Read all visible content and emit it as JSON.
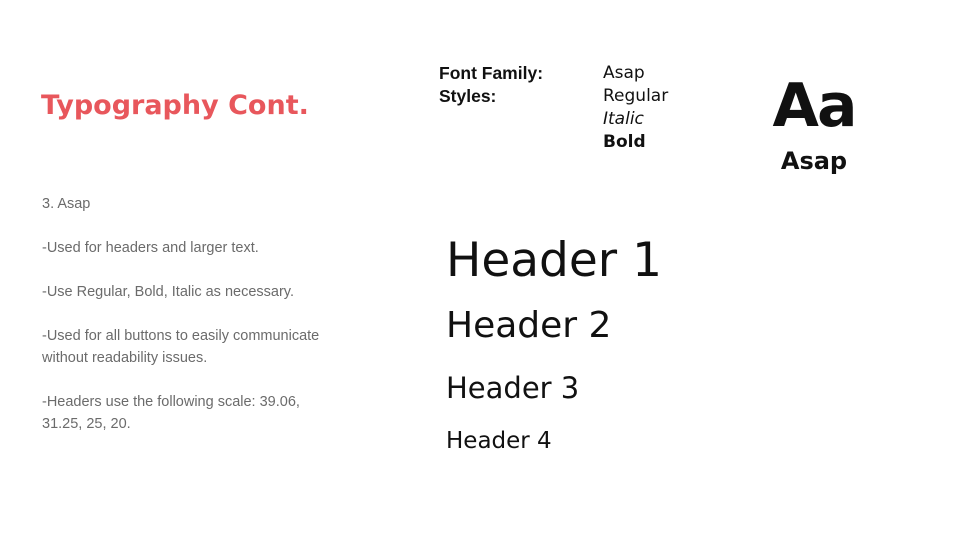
{
  "title": "Typography Cont.",
  "notes": [
    "3. Asap",
    "-Used for headers and larger text.",
    "-Use Regular, Bold, Italic as necessary.",
    "-Used for all buttons to easily communicate without readability issues.",
    "-Headers use the following scale: 39.06, 31.25, 25, 20."
  ],
  "specs": {
    "font_family_label": "Font Family:",
    "font_family_value": "Asap",
    "styles_label": "Styles:",
    "styles": [
      "Regular",
      "Italic",
      "Bold"
    ]
  },
  "specimen": {
    "glyph": "Aa",
    "name": "Asap"
  },
  "headers": [
    "Header 1",
    "Header 2",
    "Header 3",
    "Header 4"
  ],
  "colors": {
    "title": "#e8575c",
    "body_text": "#6b6b6b",
    "dark_text": "#111111",
    "background": "#ffffff"
  }
}
